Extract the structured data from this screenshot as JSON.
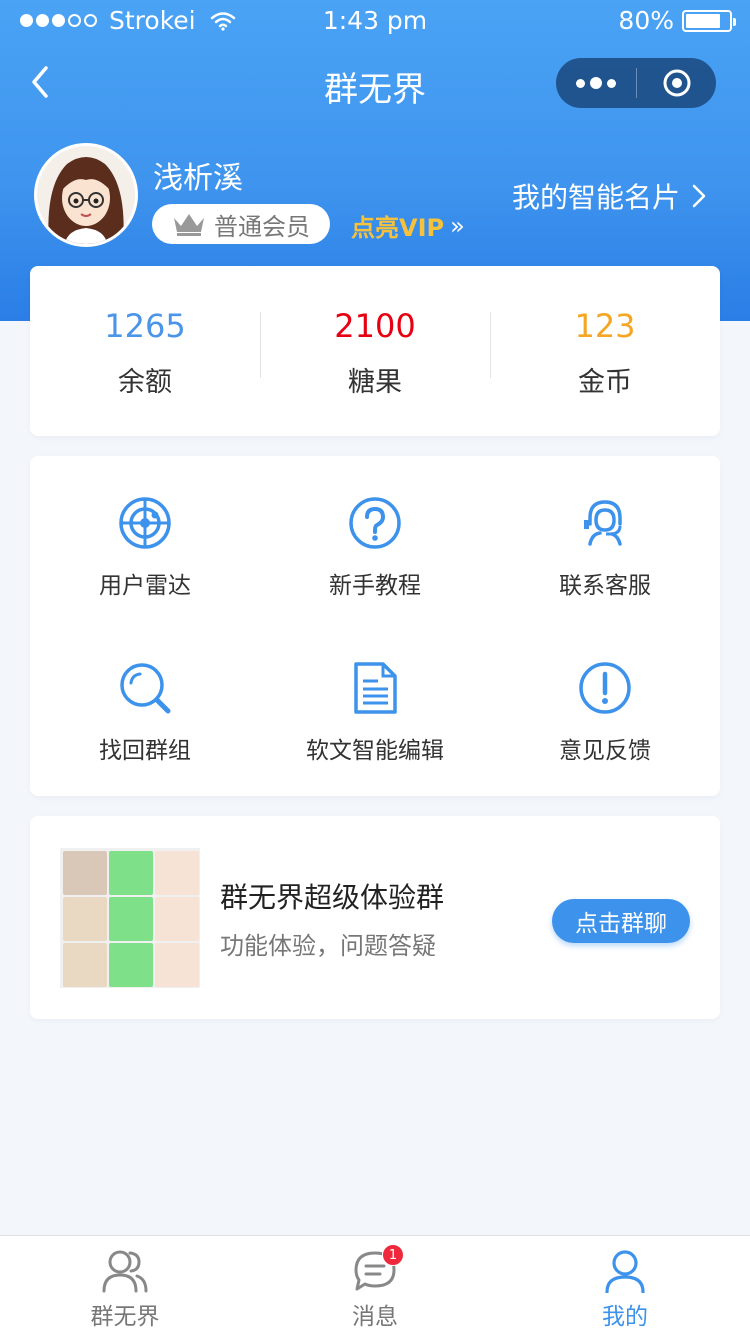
{
  "status_bar": {
    "carrier": "Strokei",
    "time": "1:43 pm",
    "battery": "80%",
    "battery_level": 0.8,
    "signal_bars_filled": 3,
    "signal_bars_total": 5
  },
  "nav": {
    "title": "群无界"
  },
  "profile": {
    "name": "浅析溪",
    "member_level": "普通会员",
    "vip_link": "点亮VIP",
    "vip_arrows": "»",
    "card_link": "我的智能名片"
  },
  "stats": [
    {
      "value": "1265",
      "label": "余额",
      "color": "#4a95e8"
    },
    {
      "value": "2100",
      "label": "糖果",
      "color": "#e60012"
    },
    {
      "value": "123",
      "label": "金币",
      "color": "#f5a623"
    }
  ],
  "menu": [
    {
      "label": "用户雷达",
      "icon": "radar-icon"
    },
    {
      "label": "新手教程",
      "icon": "help-icon"
    },
    {
      "label": "联系客服",
      "icon": "customer-service-icon"
    },
    {
      "label": "找回群组",
      "icon": "search-icon"
    },
    {
      "label": "软文智能编辑",
      "icon": "document-icon"
    },
    {
      "label": "意见反馈",
      "icon": "feedback-icon"
    }
  ],
  "group": {
    "title": "群无界超级体验群",
    "subtitle": "功能体验，问题答疑",
    "button": "点击群聊"
  },
  "tabs": [
    {
      "label": "群无界",
      "icon": "users-icon",
      "active": false
    },
    {
      "label": "消息",
      "icon": "message-icon",
      "active": false,
      "badge": "1"
    },
    {
      "label": "我的",
      "icon": "profile-icon",
      "active": true
    }
  ],
  "colors": {
    "accent": "#3d92ec",
    "header_gradient_top": "#4aa3f5",
    "header_gradient_bottom": "#2a7ee6",
    "vip": "#f6c23c"
  }
}
